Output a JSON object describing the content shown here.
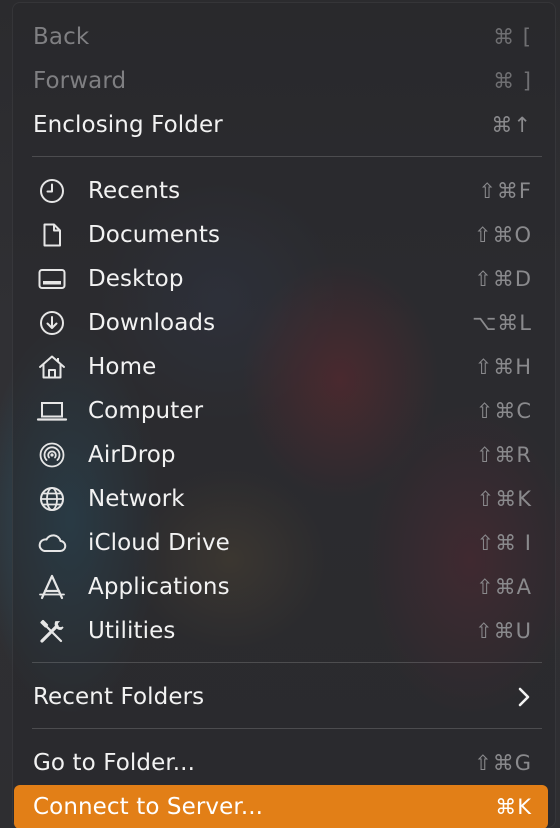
{
  "menu": {
    "history": [
      {
        "label": "Back",
        "shortcut": "⌘ [",
        "enabled": false
      },
      {
        "label": "Forward",
        "shortcut": "⌘ ]",
        "enabled": false
      },
      {
        "label": "Enclosing Folder",
        "shortcut": "⌘↑",
        "enabled": true
      }
    ],
    "locations": [
      {
        "label": "Recents",
        "shortcut": "⇧⌘F",
        "icon": "clock-icon"
      },
      {
        "label": "Documents",
        "shortcut": "⇧⌘O",
        "icon": "document-icon"
      },
      {
        "label": "Desktop",
        "shortcut": "⇧⌘D",
        "icon": "desktop-icon"
      },
      {
        "label": "Downloads",
        "shortcut": "⌥⌘L",
        "icon": "download-icon"
      },
      {
        "label": "Home",
        "shortcut": "⇧⌘H",
        "icon": "home-icon"
      },
      {
        "label": "Computer",
        "shortcut": "⇧⌘C",
        "icon": "laptop-icon"
      },
      {
        "label": "AirDrop",
        "shortcut": "⇧⌘R",
        "icon": "airdrop-icon"
      },
      {
        "label": "Network",
        "shortcut": "⇧⌘K",
        "icon": "globe-icon"
      },
      {
        "label": "iCloud Drive",
        "shortcut": "⇧⌘ I",
        "icon": "cloud-icon"
      },
      {
        "label": "Applications",
        "shortcut": "⇧⌘A",
        "icon": "applications-icon"
      },
      {
        "label": "Utilities",
        "shortcut": "⇧⌘U",
        "icon": "tools-icon"
      }
    ],
    "recent_folders": {
      "label": "Recent Folders",
      "icon": "chevron-right-icon"
    },
    "go_to_folder": {
      "label": "Go to Folder...",
      "shortcut": "⇧⌘G"
    },
    "connect_to_server": {
      "label": "Connect to Server...",
      "shortcut": "⌘K",
      "highlighted": true
    }
  },
  "colors": {
    "highlight": "#e27f17",
    "text": "#f2f2f2",
    "disabled_text": "#7f7f82",
    "shortcut_text": "#8a8a8d"
  }
}
